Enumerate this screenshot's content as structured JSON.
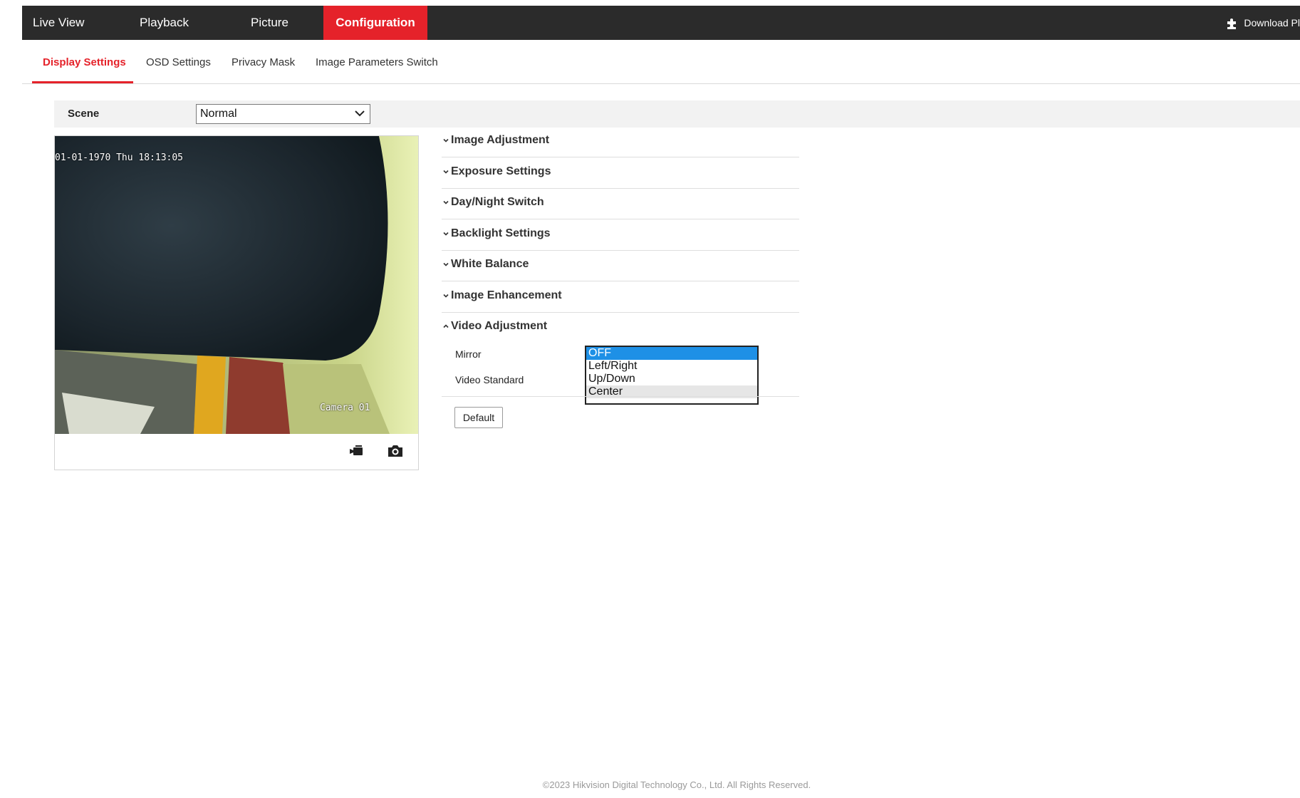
{
  "nav": {
    "items": [
      {
        "label": "Live View",
        "active": false
      },
      {
        "label": "Playback",
        "active": false
      },
      {
        "label": "Picture",
        "active": false
      },
      {
        "label": "Configuration",
        "active": true
      }
    ],
    "plugin": {
      "label": "Download Pl",
      "icon": "puzzle-icon"
    }
  },
  "subtabs": [
    {
      "label": "Display Settings",
      "active": true
    },
    {
      "label": "OSD Settings",
      "active": false
    },
    {
      "label": "Privacy Mask",
      "active": false
    },
    {
      "label": "Image Parameters Switch",
      "active": false
    }
  ],
  "scene": {
    "label": "Scene",
    "value": "Normal"
  },
  "video": {
    "timestamp": "01-01-1970 Thu 18:13:05",
    "camera_name": "Camera 01",
    "controls": [
      {
        "name": "record-icon"
      },
      {
        "name": "capture-icon"
      }
    ]
  },
  "sections": [
    {
      "title": "Image Adjustment",
      "expanded": false
    },
    {
      "title": "Exposure Settings",
      "expanded": false
    },
    {
      "title": "Day/Night Switch",
      "expanded": false
    },
    {
      "title": "Backlight Settings",
      "expanded": false
    },
    {
      "title": "White Balance",
      "expanded": false
    },
    {
      "title": "Image Enhancement",
      "expanded": false
    },
    {
      "title": "Video Adjustment",
      "expanded": true
    }
  ],
  "video_adjustment": {
    "mirror_label": "Mirror",
    "video_standard_label": "Video Standard",
    "mirror_options": [
      "OFF",
      "Left/Right",
      "Up/Down",
      "Center"
    ],
    "mirror_selected": "OFF",
    "mirror_hovered": "Center"
  },
  "default_button": "Default",
  "footer": "©2023 Hikvision Digital Technology Co., Ltd. All Rights Reserved.",
  "colors": {
    "accent": "#e5222a",
    "nav_bg": "#2b2b2b",
    "option_selected": "#1e90e6"
  }
}
